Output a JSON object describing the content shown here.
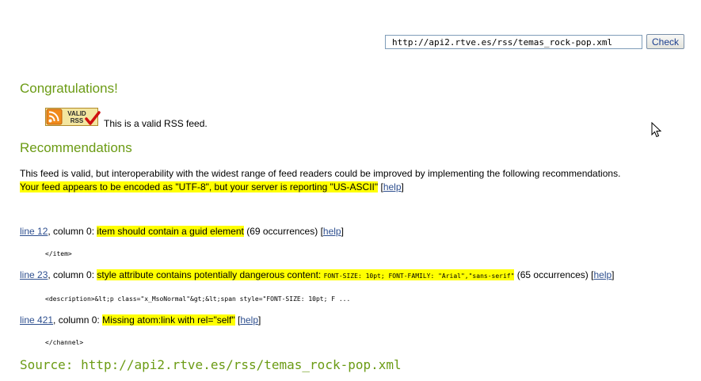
{
  "form": {
    "url_value": "http://api2.rtve.es/rss/temas_rock-pop.xml",
    "check_label": "Check"
  },
  "congrats": {
    "heading": "Congratulations!",
    "badge_line1": "VALID",
    "badge_line2": "RSS",
    "valid_text": "This is a valid RSS feed."
  },
  "recommendations": {
    "heading": "Recommendations",
    "intro": "This feed is valid, but interoperability with the widest range of feed readers could be improved by implementing the following recommendations.",
    "encoding_msg": "Your feed appears to be encoded as \"UTF-8\", but your server is reporting \"US-ASCII\"",
    "help": "help",
    "items": [
      {
        "line_link": "line 12",
        "column": ", column 0: ",
        "message": "item should contain a guid element",
        "occurrences": " (69 occurrences) ",
        "code": "</item>"
      },
      {
        "line_link": "line 23",
        "column": ", column 0: ",
        "message": "style attribute contains potentially dangerous content: ",
        "message_code": "FONT-SIZE: 10pt; FONT-FAMILY: \"Arial\",\"sans-serif\"",
        "occurrences": " (65 occurrences) ",
        "code": "<description>&lt;p class=\"x_MsoNormal\"&gt;&lt;span style=\"FONT-SIZE: 10pt; F ..."
      },
      {
        "line_link": "line 421",
        "column": ", column 0: ",
        "message": "Missing atom:link with rel=\"self\"",
        "code": "</channel>"
      }
    ]
  },
  "source": {
    "label": "Source: http://api2.rtve.es/rss/temas_rock-pop.xml"
  },
  "colors": {
    "heading_green": "#6b9b14",
    "highlight": "#ffff00",
    "link": "#2e4f8f",
    "rss_orange": "#f08a1c"
  },
  "icons": [
    "rss-icon",
    "checkmark-icon",
    "mouse-pointer-icon"
  ]
}
